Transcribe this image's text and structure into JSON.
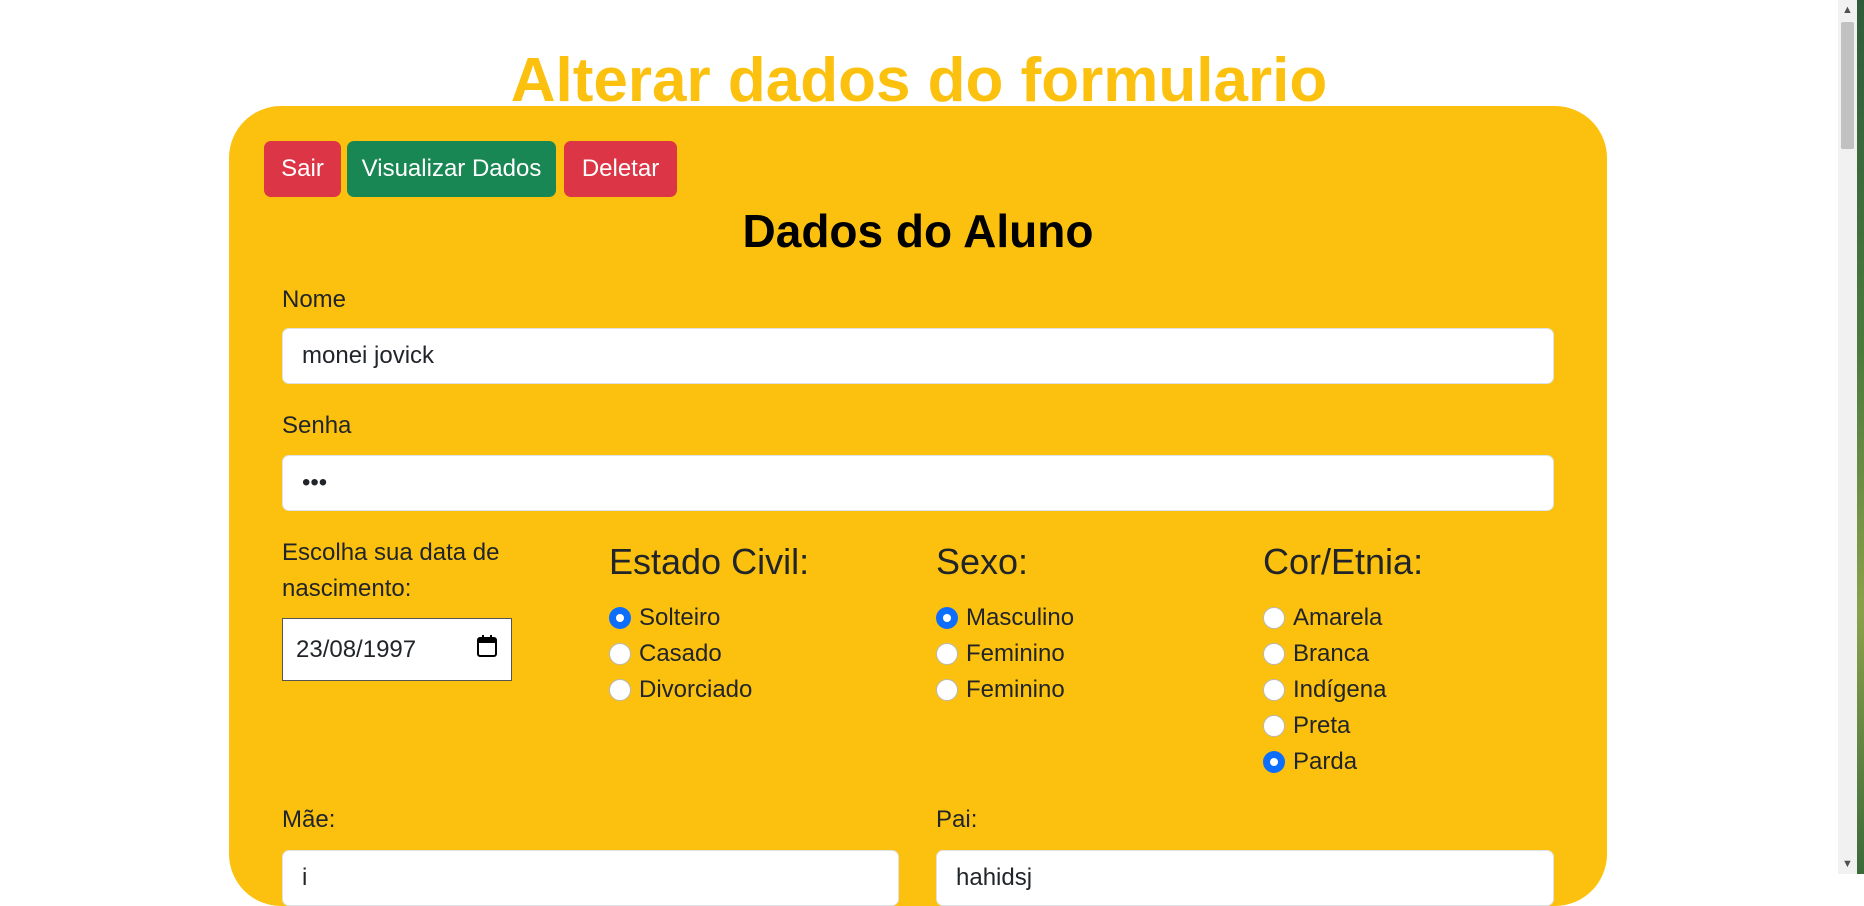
{
  "page": {
    "title": "Alterar dados do formulario"
  },
  "toolbar": {
    "exit_label": "Sair",
    "view_label": "Visualizar Dados",
    "delete_label": "Deletar"
  },
  "form": {
    "section_title": "Dados do Aluno",
    "name": {
      "label": "Nome",
      "value": "monei jovick"
    },
    "password": {
      "label": "Senha",
      "value": "•••"
    },
    "birthdate": {
      "label": "Escolha sua data de nascimento:",
      "value": "23/08/1997"
    },
    "marital": {
      "title": "Estado Civil:",
      "options": [
        {
          "label": "Solteiro",
          "checked": true
        },
        {
          "label": "Casado",
          "checked": false
        },
        {
          "label": "Divorciado",
          "checked": false
        }
      ]
    },
    "sex": {
      "title": "Sexo:",
      "options": [
        {
          "label": "Masculino",
          "checked": true
        },
        {
          "label": "Feminino",
          "checked": false
        },
        {
          "label": "Feminino",
          "checked": false
        }
      ]
    },
    "ethnicity": {
      "title": "Cor/Etnia:",
      "options": [
        {
          "label": "Amarela",
          "checked": false
        },
        {
          "label": "Branca",
          "checked": false
        },
        {
          "label": "Indígena",
          "checked": false
        },
        {
          "label": "Preta",
          "checked": false
        },
        {
          "label": "Parda",
          "checked": true
        }
      ]
    },
    "mother": {
      "label": "Mãe:",
      "value": "i"
    },
    "father": {
      "label": "Pai:",
      "value": "hahidsj"
    }
  },
  "colors": {
    "accent": "#fcc10f",
    "danger": "#dc3545",
    "success": "#198754",
    "radio_checked": "#0d6efd"
  }
}
